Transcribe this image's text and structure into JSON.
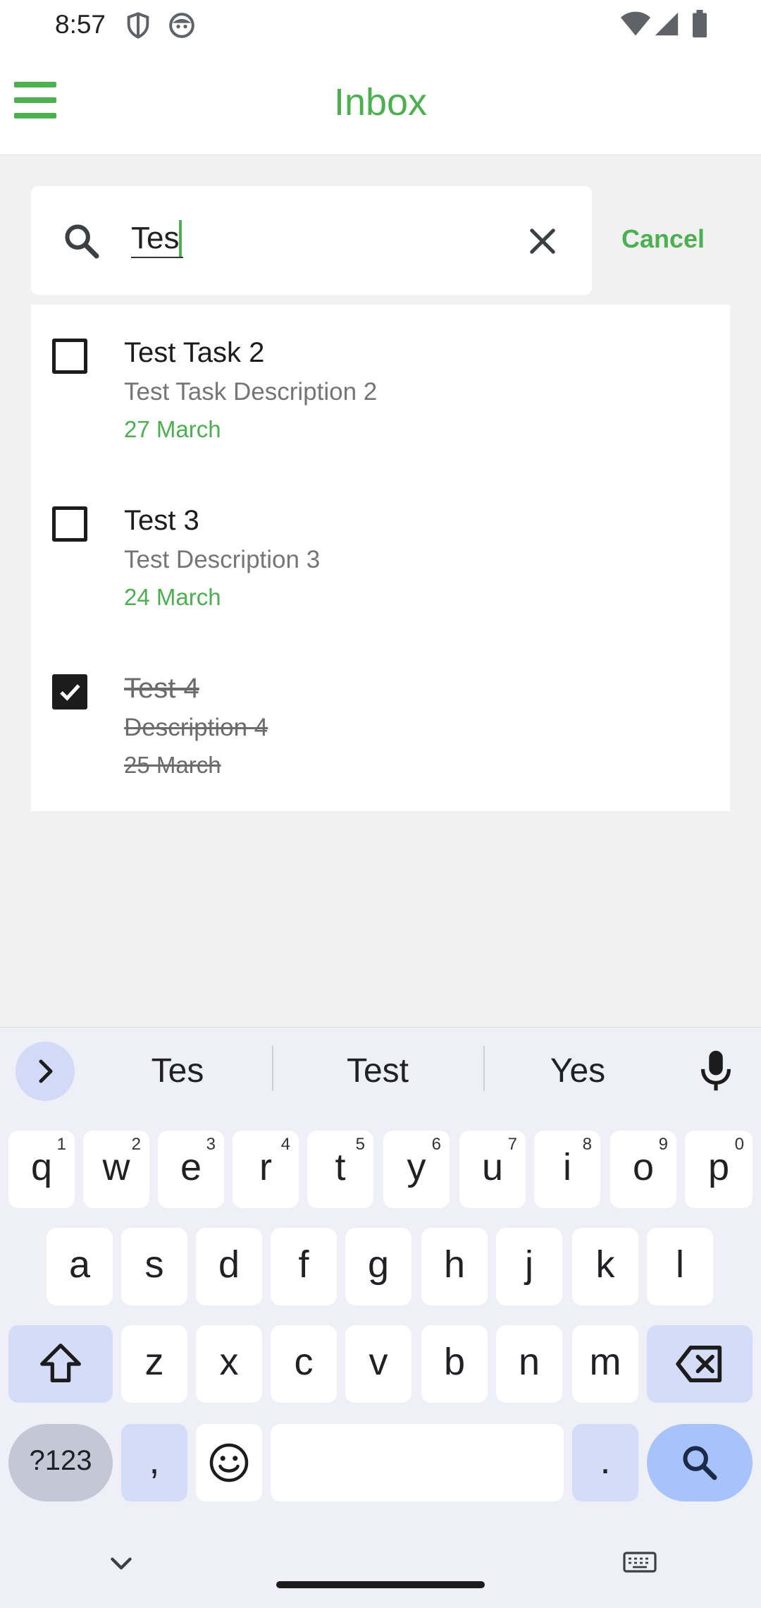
{
  "status_bar": {
    "time": "8:57"
  },
  "app_bar": {
    "title": "Inbox"
  },
  "search": {
    "query": "Tes",
    "cancel_label": "Cancel"
  },
  "tasks": [
    {
      "title": "Test Task 2",
      "description": "Test Task Description 2",
      "date": "27 March",
      "completed": false
    },
    {
      "title": "Test 3",
      "description": "Test Description 3",
      "date": "24 March",
      "completed": false
    },
    {
      "title": "Test  4",
      "description": "Description 4",
      "date": "25 March",
      "completed": true
    }
  ],
  "keyboard": {
    "suggestions": [
      "Tes",
      "Test",
      "Yes"
    ],
    "row1": [
      {
        "key": "q",
        "hint": "1"
      },
      {
        "key": "w",
        "hint": "2"
      },
      {
        "key": "e",
        "hint": "3"
      },
      {
        "key": "r",
        "hint": "4"
      },
      {
        "key": "t",
        "hint": "5"
      },
      {
        "key": "y",
        "hint": "6"
      },
      {
        "key": "u",
        "hint": "7"
      },
      {
        "key": "i",
        "hint": "8"
      },
      {
        "key": "o",
        "hint": "9"
      },
      {
        "key": "p",
        "hint": "0"
      }
    ],
    "row2": [
      "a",
      "s",
      "d",
      "f",
      "g",
      "h",
      "j",
      "k",
      "l"
    ],
    "row3": [
      "z",
      "x",
      "c",
      "v",
      "b",
      "n",
      "m"
    ],
    "symbols_label": "?123",
    "comma_label": ",",
    "period_label": "."
  },
  "colors": {
    "accent": "#4caf50",
    "background": "#f2f1f2",
    "keyboard_background": "#eff0f7"
  }
}
